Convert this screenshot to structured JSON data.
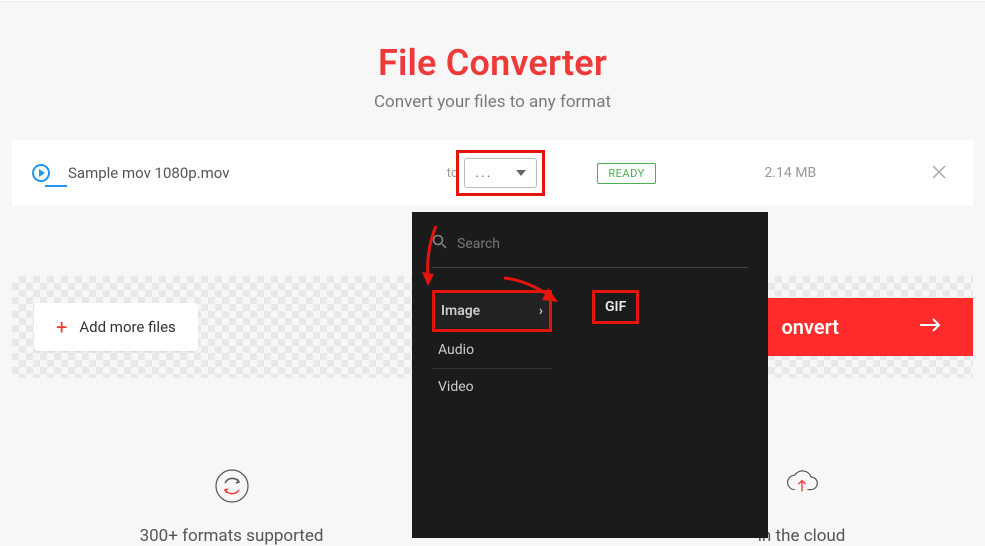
{
  "header": {
    "title": "File Converter",
    "subtitle": "Convert your files to any format"
  },
  "file": {
    "name": "Sample mov 1080p.mov",
    "to_label": "to",
    "dropdown_label": "...",
    "status": "READY",
    "size": "2.14 MB"
  },
  "actions": {
    "add_more": "Add more files",
    "convert": "onvert"
  },
  "panel": {
    "search_placeholder": "Search",
    "categories": [
      "Image",
      "Audio",
      "Video"
    ],
    "formats": [
      "GIF"
    ]
  },
  "features": {
    "f1": "300+ formats supported",
    "f2_partial1": "",
    "f3_partial": "in the cloud"
  }
}
